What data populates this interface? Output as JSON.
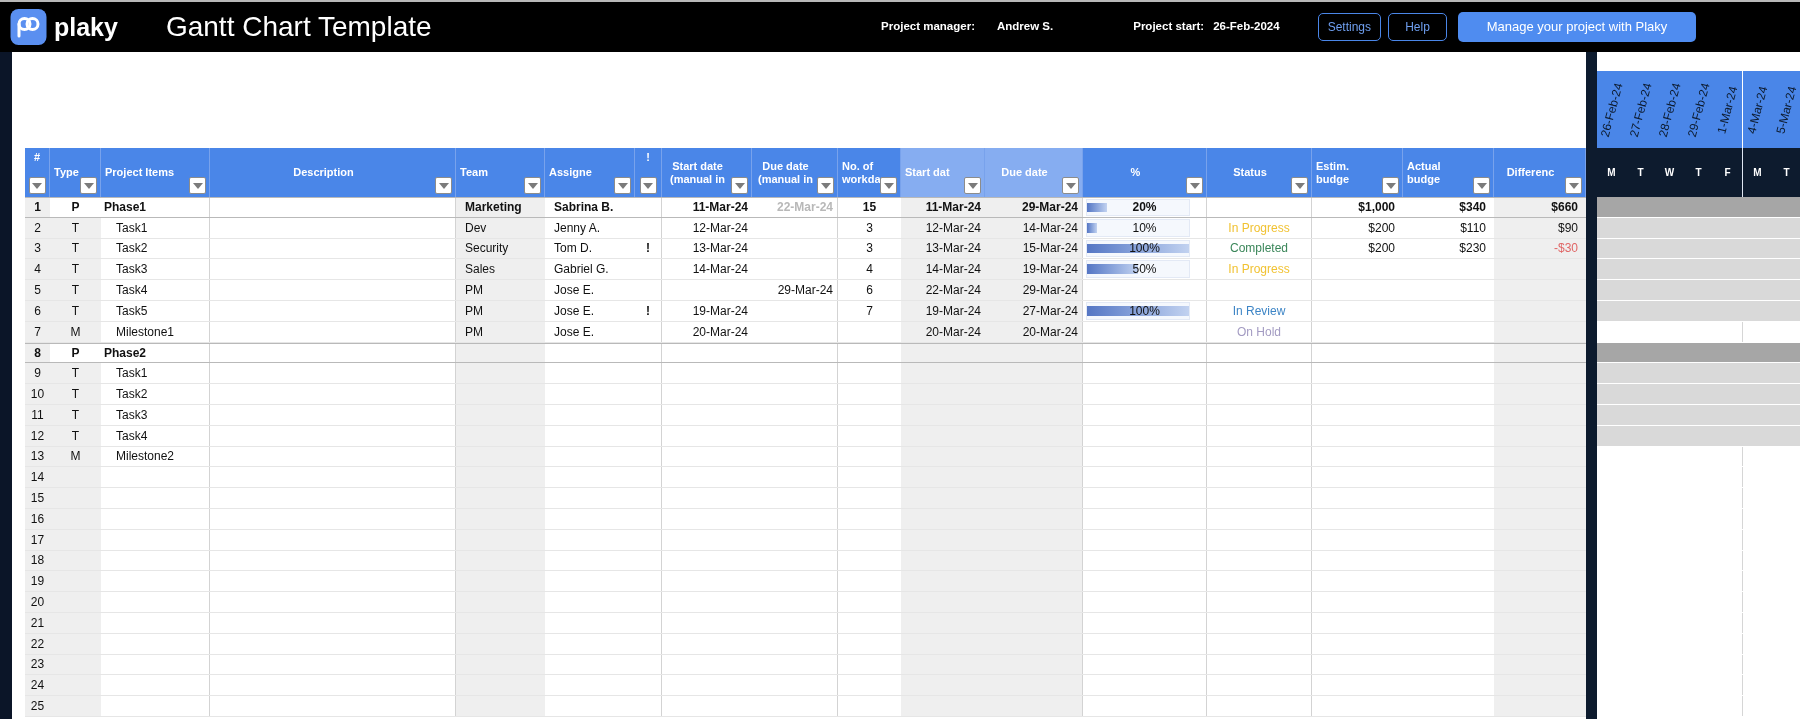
{
  "top_bar": {
    "logo_text": "plaky",
    "title": "Gantt Chart Template",
    "info": [
      {
        "label": "Project manager:",
        "value": "Andrew S."
      },
      {
        "label": "Project start:",
        "value": "26-Feb-2024"
      }
    ],
    "buttons": [
      {
        "label": "Settings",
        "kind": "outline"
      },
      {
        "label": "Help",
        "kind": "outline"
      },
      {
        "label": "Manage your project with Plaky",
        "kind": "primary"
      }
    ]
  },
  "table": {
    "columns": [
      {
        "label": "#",
        "kind": "input"
      },
      {
        "label": "Type",
        "kind": "input"
      },
      {
        "label": "Project Items",
        "kind": "input"
      },
      {
        "label": "Description",
        "kind": "input"
      },
      {
        "label": "Team",
        "kind": "input"
      },
      {
        "label": "Assigne",
        "kind": "input"
      },
      {
        "label": "!",
        "kind": "input"
      },
      {
        "label": "Start date (manual in",
        "kind": "input"
      },
      {
        "label": "Due date (manual in",
        "kind": "input"
      },
      {
        "label": "No. of workda",
        "kind": "input"
      },
      {
        "label": "Start dat",
        "kind": "computed"
      },
      {
        "label": "Due date",
        "kind": "computed"
      },
      {
        "label": "%",
        "kind": "input"
      },
      {
        "label": "Status",
        "kind": "input"
      },
      {
        "label": "Estim. budge",
        "kind": "input"
      },
      {
        "label": "Actual budge",
        "kind": "input"
      },
      {
        "label": "Differenc",
        "kind": "input"
      }
    ],
    "rows": [
      {
        "num": "1",
        "type": "P",
        "kind": "phase",
        "item": "Phase1",
        "team": "Marketing",
        "assignee": "Sabrina B.",
        "start_manual": "11-Mar-24",
        "due_manual": {
          "text": "22-Mar-24",
          "dimmed": true
        },
        "workdays": "15",
        "start": "11-Mar-24",
        "due": "29-Mar-24",
        "percent": {
          "text": "20%",
          "level": 0.2
        },
        "estimate": "$1,000",
        "actual": "$340",
        "difference": {
          "text": "$660",
          "negative": false
        }
      },
      {
        "num": "2",
        "type": "T",
        "kind": "task",
        "item": "Task1",
        "team": "Dev",
        "assignee": "Jenny A.",
        "start_manual": "12-Mar-24",
        "workdays": "3",
        "start": "12-Mar-24",
        "due": "14-Mar-24",
        "percent": {
          "text": "10%",
          "level": 0.1
        },
        "status": {
          "text": "In Progress",
          "color": "#f1c232"
        },
        "estimate": "$200",
        "actual": "$110",
        "difference": {
          "text": "$90",
          "negative": false
        }
      },
      {
        "num": "3",
        "type": "T",
        "kind": "task",
        "item": "Task2",
        "team": "Security",
        "assignee": "Tom D.",
        "flag": "!",
        "start_manual": "13-Mar-24",
        "workdays": "3",
        "start": "13-Mar-24",
        "due": "15-Mar-24",
        "percent": {
          "text": "100%",
          "level": 1
        },
        "status": {
          "text": "Completed",
          "color": "#3a8659"
        },
        "estimate": "$200",
        "actual": "$230",
        "difference": {
          "text": "-$30",
          "negative": true
        }
      },
      {
        "num": "4",
        "type": "T",
        "kind": "task",
        "item": "Task3",
        "team": "Sales",
        "assignee": "Gabriel G.",
        "start_manual": "14-Mar-24",
        "workdays": "4",
        "start": "14-Mar-24",
        "due": "19-Mar-24",
        "percent": {
          "text": "50%",
          "level": 0.5
        },
        "status": {
          "text": "In Progress",
          "color": "#f1c232"
        }
      },
      {
        "num": "5",
        "type": "T",
        "kind": "task",
        "item": "Task4",
        "team": "PM",
        "assignee": "Jose E.",
        "due_manual": {
          "text": "29-Mar-24",
          "dimmed": false
        },
        "workdays": "6",
        "start": "22-Mar-24",
        "due": "29-Mar-24"
      },
      {
        "num": "6",
        "type": "T",
        "kind": "task",
        "item": "Task5",
        "team": "PM",
        "assignee": "Jose E.",
        "flag": "!",
        "start_manual": "19-Mar-24",
        "workdays": "7",
        "start": "19-Mar-24",
        "due": "27-Mar-24",
        "percent": {
          "text": "100%",
          "level": 1
        },
        "status": {
          "text": "In Review",
          "color": "#3d85c6"
        }
      },
      {
        "num": "7",
        "type": "M",
        "kind": "milestone",
        "item": "Milestone1",
        "team": "PM",
        "assignee": "Jose E.",
        "start_manual": "20-Mar-24",
        "start": "20-Mar-24",
        "due": "20-Mar-24",
        "status": {
          "text": "On Hold",
          "color": "#a39bc2"
        }
      },
      {
        "num": "8",
        "type": "P",
        "kind": "phase",
        "item": "Phase2"
      },
      {
        "num": "9",
        "type": "T",
        "kind": "task",
        "item": "Task1"
      },
      {
        "num": "10",
        "type": "T",
        "kind": "task",
        "item": "Task2"
      },
      {
        "num": "11",
        "type": "T",
        "kind": "task",
        "item": "Task3"
      },
      {
        "num": "12",
        "type": "T",
        "kind": "task",
        "item": "Task4"
      },
      {
        "num": "13",
        "type": "M",
        "kind": "milestone",
        "item": "Milestone2"
      },
      {
        "num": "14",
        "kind": "blank"
      },
      {
        "num": "15",
        "kind": "blank"
      },
      {
        "num": "16",
        "kind": "blank"
      },
      {
        "num": "17",
        "kind": "blank"
      },
      {
        "num": "18",
        "kind": "blank"
      },
      {
        "num": "19",
        "kind": "blank"
      },
      {
        "num": "20",
        "kind": "blank"
      },
      {
        "num": "21",
        "kind": "blank"
      },
      {
        "num": "22",
        "kind": "blank"
      },
      {
        "num": "23",
        "kind": "blank"
      },
      {
        "num": "24",
        "kind": "blank"
      },
      {
        "num": "25",
        "kind": "blank"
      }
    ]
  },
  "gantt": {
    "dates": [
      {
        "date": "26-Feb-24",
        "day": "M",
        "week_start": false
      },
      {
        "date": "27-Feb-24",
        "day": "T",
        "week_start": false
      },
      {
        "date": "28-Feb-24",
        "day": "W",
        "week_start": false
      },
      {
        "date": "29-Feb-24",
        "day": "T",
        "week_start": false
      },
      {
        "date": "1-Mar-24",
        "day": "F",
        "week_start": false
      },
      {
        "date": "4-Mar-24",
        "day": "M",
        "week_start": true
      },
      {
        "date": "5-Mar-24",
        "day": "T",
        "week_start": false
      }
    ]
  }
}
